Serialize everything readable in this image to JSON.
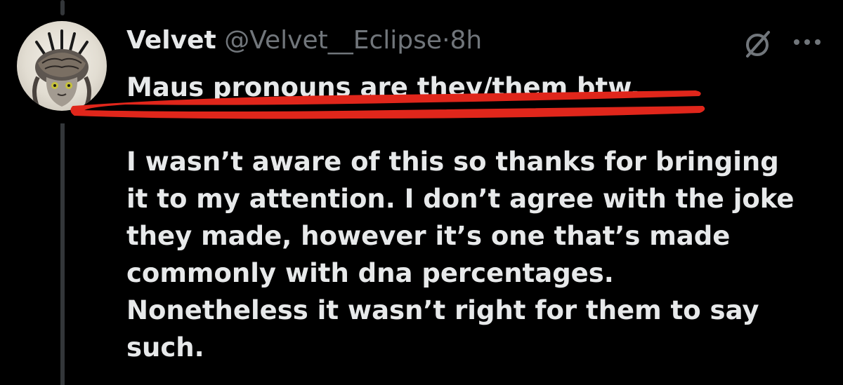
{
  "tweet": {
    "display_name": "Velvet",
    "handle": "@Velvet__Eclipse",
    "separator": "·",
    "timestamp": "8h",
    "first_line": "Maus pronouns are they/them btw.",
    "paragraph_lines": [
      "I wasn’t aware of this so thanks for bringing",
      "it to my attention. I don’t agree with the joke",
      "they made, however it’s one that’s made",
      "commonly with dna percentages.",
      "Nonetheless it wasn’t right for them to say",
      "such."
    ]
  },
  "icons": {
    "grok": "grok-slash-icon",
    "more": "more-dots-icon"
  },
  "colors": {
    "background": "#000000",
    "text": "#e7e9ea",
    "muted": "#71767b",
    "annotation": "#e0261b"
  }
}
